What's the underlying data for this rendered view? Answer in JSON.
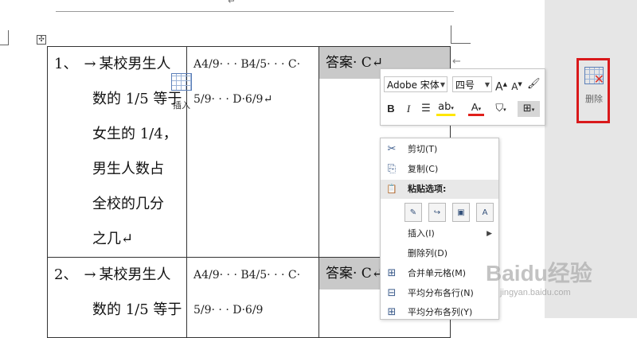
{
  "document": {
    "paragraph_mark": "↵",
    "end_mark": "←",
    "move_handle": "✣",
    "rows": [
      {
        "question_lines": [
          "1、",
          "某校男生人",
          "数的 1/5 等于",
          "女生的 1/4，",
          "男生人数占",
          "全校的几分",
          "之几↵"
        ],
        "option_lines": [
          "A4/9· · · B4/5· · · C·",
          "5/9· · · D·6/9↵"
        ],
        "answer": "答案· C↵"
      },
      {
        "question_lines": [
          "2、",
          "某校男生人",
          "数的 1/5 等于"
        ],
        "option_lines": [
          "A4/9· · · B4/5· · · C·",
          "5/9· · · D·6/9"
        ],
        "answer": "答案· C↵"
      }
    ],
    "arrow": "→"
  },
  "mini_toolbar": {
    "font_name": "Adobe 宋体",
    "font_size": "四号",
    "grow_font": "A",
    "shrink_font": "A",
    "bold": "B",
    "italic": "I",
    "font_color_label": "A",
    "insert_label": "插入",
    "delete_label": "删除"
  },
  "context_menu": {
    "items": [
      {
        "icon": "✂",
        "label": "剪切(T)"
      },
      {
        "icon": "⎘",
        "label": "复制(C)"
      },
      {
        "icon": "📋",
        "label": "粘贴选项:"
      },
      {
        "icon": "",
        "label": "插入(I)"
      },
      {
        "icon": "",
        "label": "删除列(D)"
      },
      {
        "icon": "⊞",
        "label": "合并单元格(M)"
      },
      {
        "icon": "⊟",
        "label": "平均分布各行(N)"
      },
      {
        "icon": "⊞",
        "label": "平均分布各列(Y)"
      }
    ]
  },
  "watermark": {
    "text": "Baidu经验",
    "url": "jingyan.baidu.com"
  },
  "colors": {
    "highlight_red": "#d9191b",
    "answer_shade": "#c9c9c9",
    "sidebar_gray": "#e6e6e6"
  }
}
